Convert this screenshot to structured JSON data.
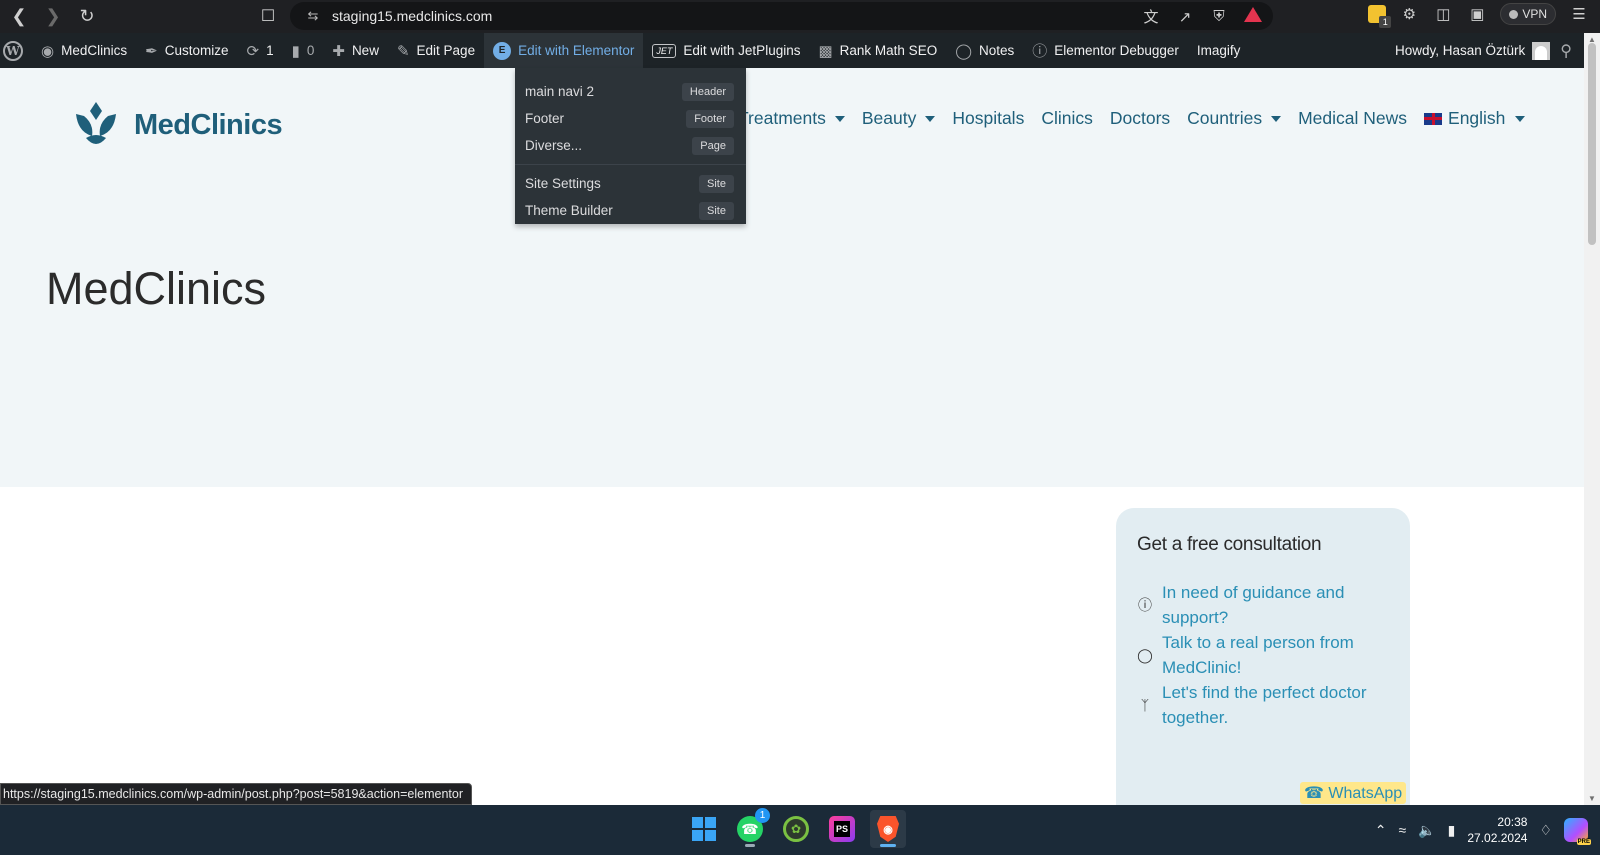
{
  "browser": {
    "url": "staging15.medclinics.com",
    "vpn_label": "VPN",
    "ext_badge": "1"
  },
  "admin_bar": {
    "items": [
      {
        "label": "MedClinics"
      },
      {
        "label": "Customize"
      },
      {
        "label": "1"
      },
      {
        "label": "0"
      },
      {
        "label": "New"
      },
      {
        "label": "Edit Page"
      },
      {
        "label": "Edit with Elementor"
      },
      {
        "label": "Edit with JetPlugins"
      },
      {
        "label": "Rank Math SEO"
      },
      {
        "label": "Notes"
      },
      {
        "label": "Elementor Debugger"
      },
      {
        "label": "Imagify"
      }
    ],
    "jet_text": "JET",
    "howdy": "Howdy, Hasan Öztürk"
  },
  "elementor_menu": {
    "items": [
      {
        "label": "main navi 2",
        "tag": "Header"
      },
      {
        "label": "Footer",
        "tag": "Footer"
      },
      {
        "label": "Diverse...",
        "tag": "Page"
      },
      {
        "label": "Site Settings",
        "tag": "Site"
      },
      {
        "label": "Theme Builder",
        "tag": "Site"
      }
    ]
  },
  "site": {
    "logo_text": "MedClinics",
    "nav": [
      {
        "label": "Treatments",
        "dropdown": true
      },
      {
        "label": "Beauty",
        "dropdown": true
      },
      {
        "label": "Hospitals",
        "dropdown": false
      },
      {
        "label": "Clinics",
        "dropdown": false
      },
      {
        "label": "Doctors",
        "dropdown": false
      },
      {
        "label": "Countries",
        "dropdown": true
      },
      {
        "label": "Medical News",
        "dropdown": false
      },
      {
        "label": "English",
        "dropdown": true
      }
    ],
    "page_title": "MedClinics"
  },
  "consultation": {
    "title": "Get a free consultation",
    "items": [
      {
        "icon": "question-circle-icon",
        "text": "In need of guidance and support?"
      },
      {
        "icon": "chat-bubbles-icon",
        "text": "Talk to a real person from MedClinic!"
      },
      {
        "icon": "stethoscope-icon",
        "text": "Let's find the perfect doctor together."
      }
    ],
    "whatsapp_label": "WhatsApp"
  },
  "status_url": "https://staging15.medclinics.com/wp-admin/post.php?post=5819&action=elementor",
  "taskbar": {
    "whatsapp_badge": "1",
    "ps_text": "PS",
    "time": "20:38",
    "date": "27.02.2024",
    "copilot_badge": "PRE"
  },
  "colors": {
    "brand": "#1f5f7a",
    "link": "#2a8fb5",
    "admin_bar_bg": "#1d2327",
    "admin_active": "#72aee6"
  }
}
